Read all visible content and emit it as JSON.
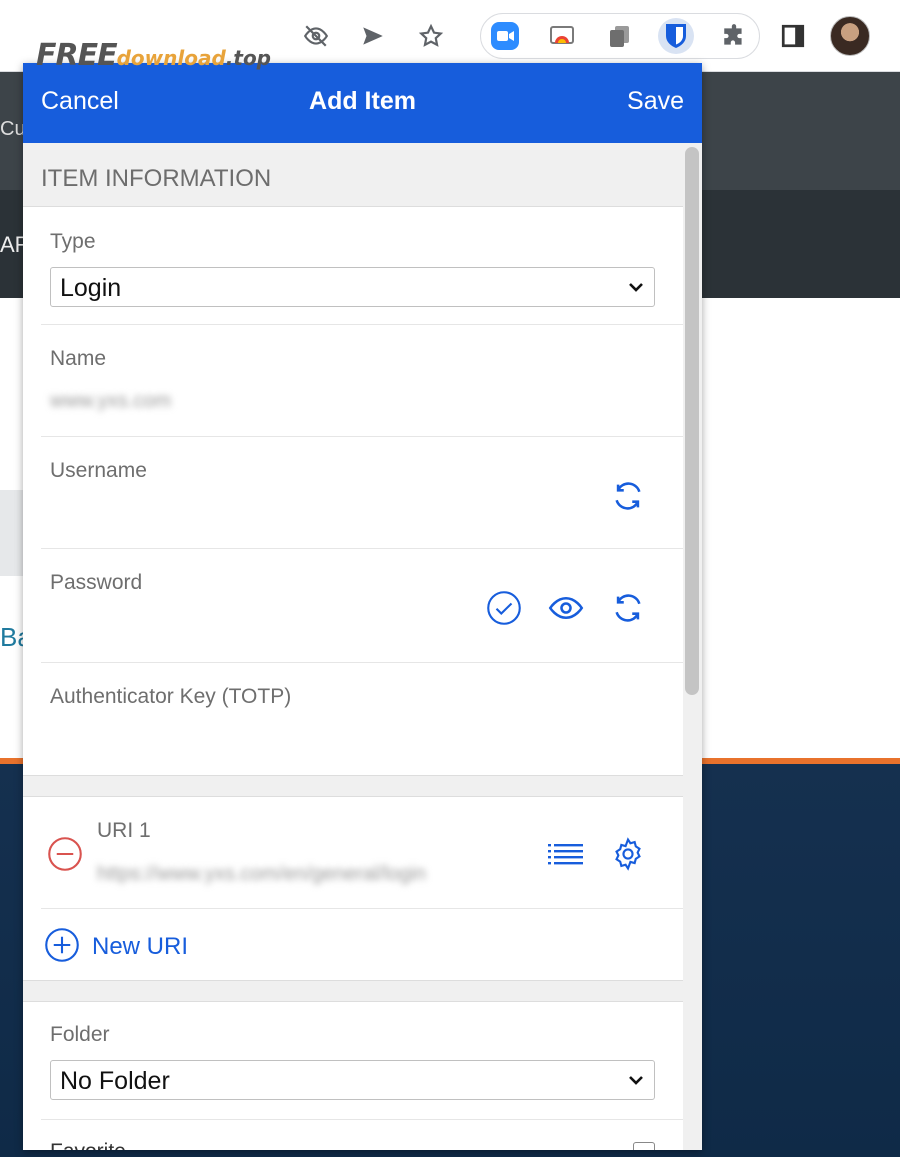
{
  "watermark": {
    "part1": "FREE",
    "part2": "download",
    "part3": ".top"
  },
  "background_page": {
    "fragment_top": "Cus",
    "fragment_mid": "ARC",
    "fragment_link": "Ba"
  },
  "header": {
    "cancel_label": "Cancel",
    "title": "Add Item",
    "save_label": "Save"
  },
  "item_information": {
    "section_title": "ITEM INFORMATION",
    "type": {
      "label": "Type",
      "value": "Login"
    },
    "name": {
      "label": "Name",
      "value": "www.yxs.com"
    },
    "username": {
      "label": "Username"
    },
    "password": {
      "label": "Password"
    },
    "totp": {
      "label": "Authenticator Key (TOTP)"
    }
  },
  "uris": {
    "items": [
      {
        "label": "URI 1",
        "value": "https://www.yxs.com/en/general/login"
      }
    ],
    "new_uri_label": "New URI"
  },
  "folder": {
    "label": "Folder",
    "value": "No Folder"
  },
  "favorite": {
    "label": "Favorite"
  },
  "colors": {
    "accent": "#175ddc",
    "remove": "#d9534f",
    "background_orange": "#e8722c"
  },
  "icons": {
    "toolbar": [
      "eye-off-icon",
      "send-icon",
      "star-icon"
    ],
    "extensions": [
      "zoom-extension-icon",
      "slides-extension-icon",
      "copy-extension-icon",
      "bitwarden-extension-icon",
      "puzzle-extensions-icon",
      "side-panel-icon"
    ],
    "fields": [
      "regenerate-username-icon",
      "check-password-icon",
      "toggle-visibility-icon",
      "generate-password-icon",
      "remove-uri-icon",
      "uri-list-icon",
      "uri-settings-icon",
      "add-uri-icon"
    ]
  }
}
